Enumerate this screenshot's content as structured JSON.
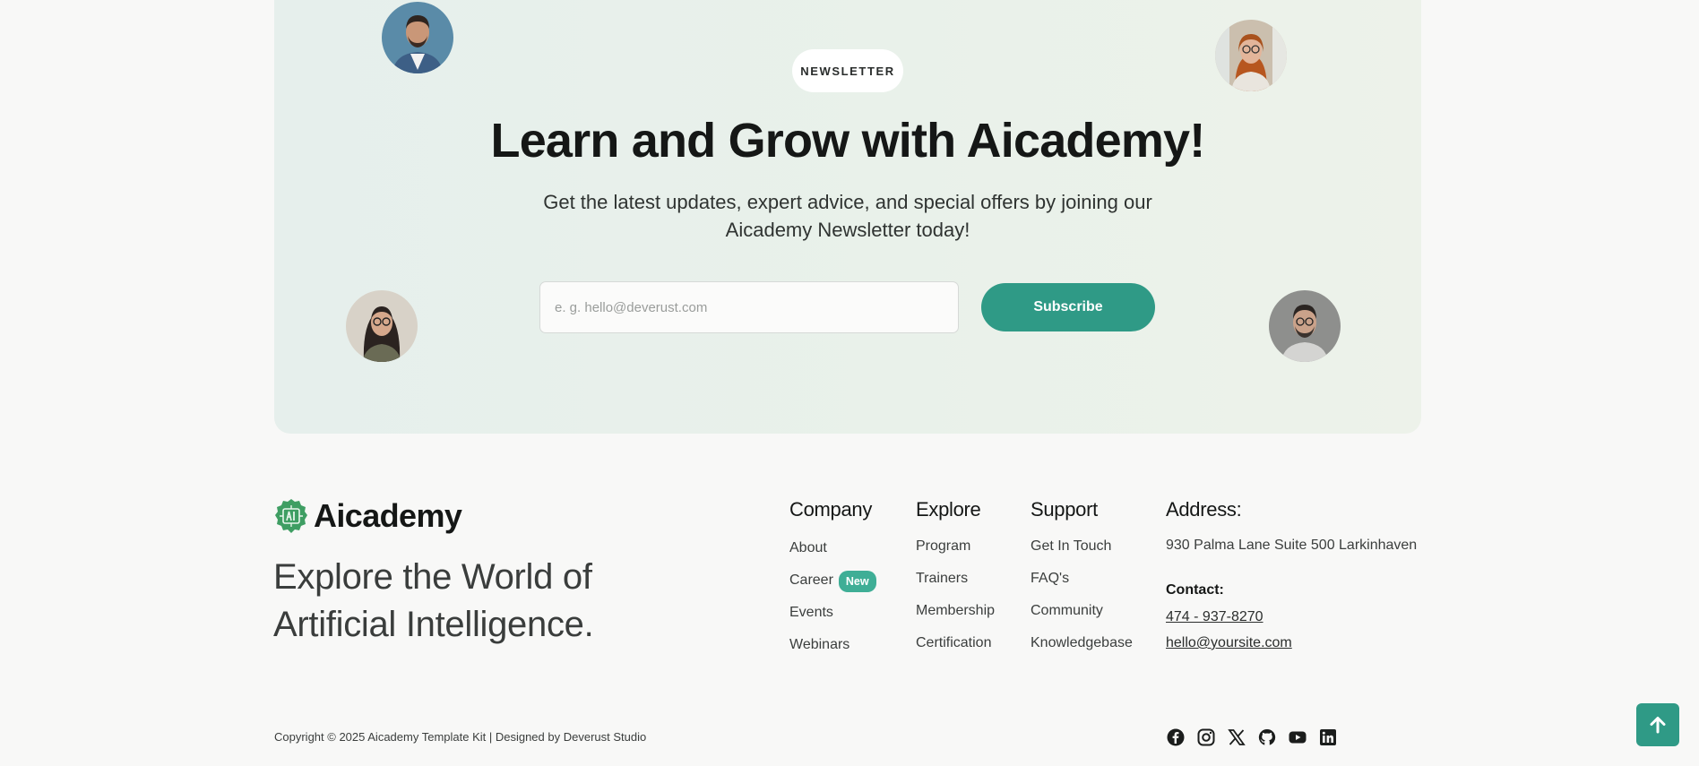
{
  "colors": {
    "accent": "#2f9a86",
    "new_badge": "#3fae96",
    "card_bg": "#e8f0eb"
  },
  "newsletter": {
    "badge": "NEWSLETTER",
    "title": "Learn and Grow with Aicademy!",
    "subtitle": "Get the latest updates, expert advice, and special offers by joining our Aicademy Newsletter today!",
    "email_placeholder": "e. g. hello@deverust.com",
    "subscribe_label": "Subscribe"
  },
  "footer": {
    "brand": "Aicademy",
    "tagline": "Explore the World of Artificial Intelligence.",
    "company": {
      "heading": "Company",
      "items": [
        {
          "label": "About"
        },
        {
          "label": "Career",
          "badge": "New"
        },
        {
          "label": "Events"
        },
        {
          "label": "Webinars"
        }
      ]
    },
    "explore": {
      "heading": "Explore",
      "items": [
        {
          "label": "Program"
        },
        {
          "label": "Trainers"
        },
        {
          "label": "Membership"
        },
        {
          "label": "Certification"
        }
      ]
    },
    "support": {
      "heading": "Support",
      "items": [
        {
          "label": "Get In Touch"
        },
        {
          "label": "FAQ's"
        },
        {
          "label": "Community"
        },
        {
          "label": "Knowledgebase"
        }
      ]
    },
    "address": {
      "heading": "Address:",
      "line": "930 Palma Lane Suite 500 Larkinhaven",
      "contact_label": "Contact:",
      "phone": "474 - 937-8270",
      "email": "hello@yoursite.com"
    },
    "copyright": "Copyright © 2025 Aicademy Template Kit | Designed by Deverust Studio",
    "socials": [
      "facebook-icon",
      "instagram-icon",
      "x-icon",
      "github-icon",
      "youtube-icon",
      "linkedin-icon"
    ]
  },
  "back_to_top_icon": "arrow-up-icon"
}
